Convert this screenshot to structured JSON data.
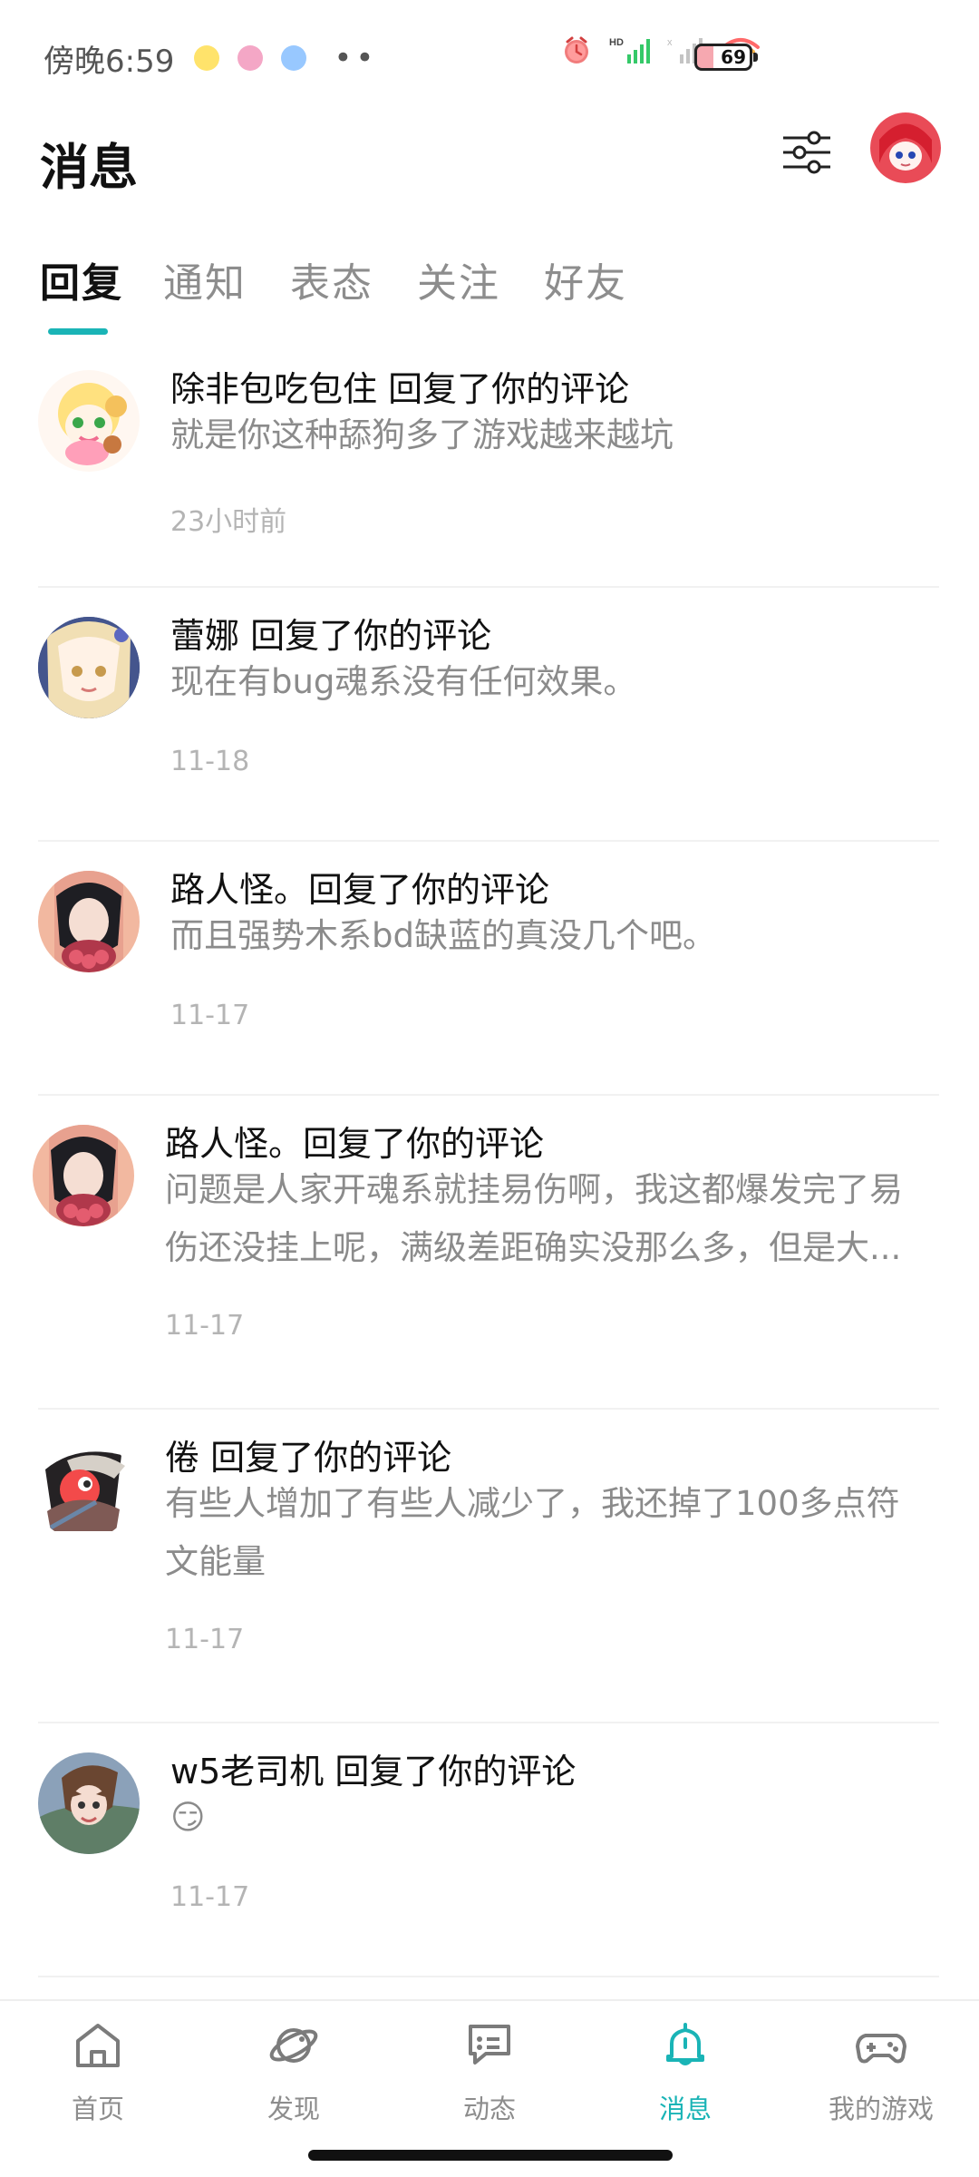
{
  "status_bar": {
    "time": "傍晚6:59",
    "dots": "••",
    "battery_percent": "69",
    "icons": [
      "alarm-icon",
      "hd-signal-icon",
      "signal-icon",
      "wifi-icon"
    ]
  },
  "header": {
    "title": "消息"
  },
  "tabs": [
    {
      "label": "回复",
      "active": true
    },
    {
      "label": "通知",
      "active": false
    },
    {
      "label": "表态",
      "active": false
    },
    {
      "label": "关注",
      "active": false
    },
    {
      "label": "好友",
      "active": false
    }
  ],
  "messages": [
    {
      "title": "除非包吃包住 回复了你的评论",
      "body": "就是你这种舔狗多了游戏越来越坑",
      "time": "23小时前",
      "avatar": "girl-blonde-pink-avatar"
    },
    {
      "title": "蕾娜 回复了你的评论",
      "body": "现在有bug魂系没有任何效果。",
      "time": "11-18",
      "avatar": "blonde-anime-avatar"
    },
    {
      "title": "路人怪。回复了你的评论",
      "body": "而且强势木系bd缺蓝的真没几个吧。",
      "time": "11-17",
      "avatar": "dark-hair-roses-avatar"
    },
    {
      "title": "路人怪。回复了你的评论",
      "body": "问题是人家开魂系就挂易伤啊，我这都爆发完了易伤还没挂上呢，满级差距确实没那么多，但是大...",
      "time": "11-17",
      "avatar": "dark-hair-roses-avatar"
    },
    {
      "title": "倦 回复了你的评论",
      "body": "有些人增加了有些人减少了，我还掉了100多点符文能量",
      "time": "11-17",
      "avatar": "red-black-warrior-avatar"
    },
    {
      "title": "w5老司机 回复了你的评论",
      "body": "😏",
      "time": "11-17",
      "avatar": "brown-hair-anime-avatar"
    }
  ],
  "bottom_nav": [
    {
      "label": "首页",
      "icon": "home-icon",
      "active": false
    },
    {
      "label": "发现",
      "icon": "planet-icon",
      "active": false
    },
    {
      "label": "动态",
      "icon": "chat-bubble-icon",
      "active": false
    },
    {
      "label": "消息",
      "icon": "bell-icon",
      "active": true
    },
    {
      "label": "我的游戏",
      "icon": "gamepad-icon",
      "active": false
    }
  ],
  "colors": {
    "accent": "#1ab4b6",
    "muted_text": "#8b8b8b",
    "time_text": "#b4b4b4"
  }
}
